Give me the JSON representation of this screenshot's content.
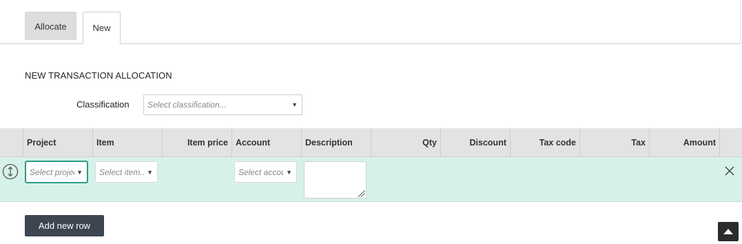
{
  "tabs": {
    "allocate": "Allocate",
    "new": "New"
  },
  "section": {
    "title": "NEW TRANSACTION ALLOCATION"
  },
  "classification": {
    "label": "Classification",
    "placeholder": "Select classification..."
  },
  "table": {
    "columns": {
      "project": "Project",
      "item": "Item",
      "item_price": "Item price",
      "account": "Account",
      "description": "Description",
      "qty": "Qty",
      "discount": "Discount",
      "tax_code": "Tax code",
      "tax": "Tax",
      "amount": "Amount"
    },
    "row": {
      "project_placeholder": "Select project...",
      "item_placeholder": "Select item...",
      "account_placeholder": "Select account...",
      "description_value": ""
    }
  },
  "buttons": {
    "add_row": "Add new row"
  },
  "icons": {
    "move": "move-vertical-icon",
    "caret": "caret-down-icon",
    "close": "close-icon",
    "scroll_top": "caret-up-icon"
  },
  "colors": {
    "row_background": "#d6f2e8",
    "focus_accent": "#2f9a87",
    "header_background": "#e3e3e3",
    "primary_button": "#3c4550"
  }
}
